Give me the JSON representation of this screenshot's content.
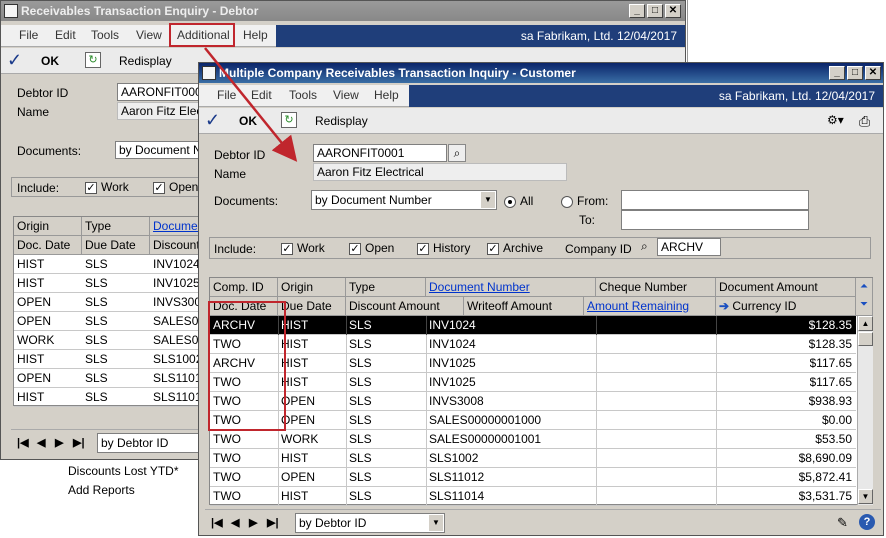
{
  "back_window": {
    "title": "Receivables Transaction Enquiry - Debtor",
    "menu": [
      "File",
      "Edit",
      "Tools",
      "View",
      "Additional",
      "Help"
    ],
    "user_company_date": "sa  Fabrikam, Ltd.  12/04/2017",
    "toolbar": {
      "ok": "OK",
      "redisplay": "Redisplay"
    },
    "debtor_id_label": "Debtor ID",
    "debtor_id": "AARONFIT0001",
    "name_label": "Name",
    "name": "Aaron Fitz Electrical",
    "documents_label": "Documents:",
    "documents": "by Document Number",
    "include_label": "Include:",
    "include": [
      "Work",
      "Open"
    ],
    "headers_row1": [
      "Origin",
      "Type",
      "Document"
    ],
    "headers_row2": [
      "Doc. Date",
      "Due Date",
      "Discount"
    ],
    "rows": [
      [
        "HIST",
        "SLS",
        "INV1024"
      ],
      [
        "HIST",
        "SLS",
        "INV1025"
      ],
      [
        "OPEN",
        "SLS",
        "INVS3008"
      ],
      [
        "OPEN",
        "SLS",
        "SALES00"
      ],
      [
        "WORK",
        "SLS",
        "SALES00"
      ],
      [
        "HIST",
        "SLS",
        "SLS1002"
      ],
      [
        "OPEN",
        "SLS",
        "SLS1101"
      ],
      [
        "HIST",
        "SLS",
        "SLS1101"
      ]
    ],
    "sort": "by Debtor ID",
    "sidebar_links": [
      "Discounts Lost YTD*",
      "Add Reports"
    ]
  },
  "front_window": {
    "title": "Multiple Company Receivables Transaction Inquiry - Customer",
    "menu": [
      "File",
      "Edit",
      "Tools",
      "View",
      "Help"
    ],
    "user_company_date": "sa  Fabrikam, Ltd.  12/04/2017",
    "toolbar": {
      "ok": "OK",
      "redisplay": "Redisplay"
    },
    "debtor_id_label": "Debtor ID",
    "debtor_id": "AARONFIT0001",
    "name_label": "Name",
    "name": "Aaron Fitz Electrical",
    "documents_label": "Documents:",
    "documents": "by Document Number",
    "all_label": "All",
    "from_label": "From:",
    "to_label": "To:",
    "include_label": "Include:",
    "include": [
      "Work",
      "Open",
      "History",
      "Archive"
    ],
    "company_id_label": "Company ID",
    "company_id": "ARCHV",
    "headers_row1": [
      "Comp. ID",
      "Origin",
      "Type",
      "Document Number",
      "Cheque Number",
      "Document Amount"
    ],
    "headers_row2": [
      "Doc. Date",
      "Due Date",
      "Discount Amount",
      "Writeoff Amount",
      "Amount Remaining",
      "Currency ID"
    ],
    "rows": [
      {
        "comp": "ARCHV",
        "origin": "HIST",
        "type": "SLS",
        "doc": "INV1024",
        "amount": "$128.35"
      },
      {
        "comp": "TWO",
        "origin": "HIST",
        "type": "SLS",
        "doc": "INV1024",
        "amount": "$128.35"
      },
      {
        "comp": "ARCHV",
        "origin": "HIST",
        "type": "SLS",
        "doc": "INV1025",
        "amount": "$117.65"
      },
      {
        "comp": "TWO",
        "origin": "HIST",
        "type": "SLS",
        "doc": "INV1025",
        "amount": "$117.65"
      },
      {
        "comp": "TWO",
        "origin": "OPEN",
        "type": "SLS",
        "doc": "INVS3008",
        "amount": "$938.93"
      },
      {
        "comp": "TWO",
        "origin": "OPEN",
        "type": "SLS",
        "doc": "SALES00000001000",
        "amount": "$0.00"
      },
      {
        "comp": "TWO",
        "origin": "WORK",
        "type": "SLS",
        "doc": "SALES00000001001",
        "amount": "$53.50"
      },
      {
        "comp": "TWO",
        "origin": "HIST",
        "type": "SLS",
        "doc": "SLS1002",
        "amount": "$8,690.09"
      },
      {
        "comp": "TWO",
        "origin": "OPEN",
        "type": "SLS",
        "doc": "SLS11012",
        "amount": "$5,872.41"
      },
      {
        "comp": "TWO",
        "origin": "HIST",
        "type": "SLS",
        "doc": "SLS11014",
        "amount": "$3,531.75"
      }
    ],
    "sort": "by Debtor ID"
  },
  "colors": {
    "highlight": "#c0262d",
    "title_active": "#0a246a",
    "banner": "#1f3e7a"
  }
}
